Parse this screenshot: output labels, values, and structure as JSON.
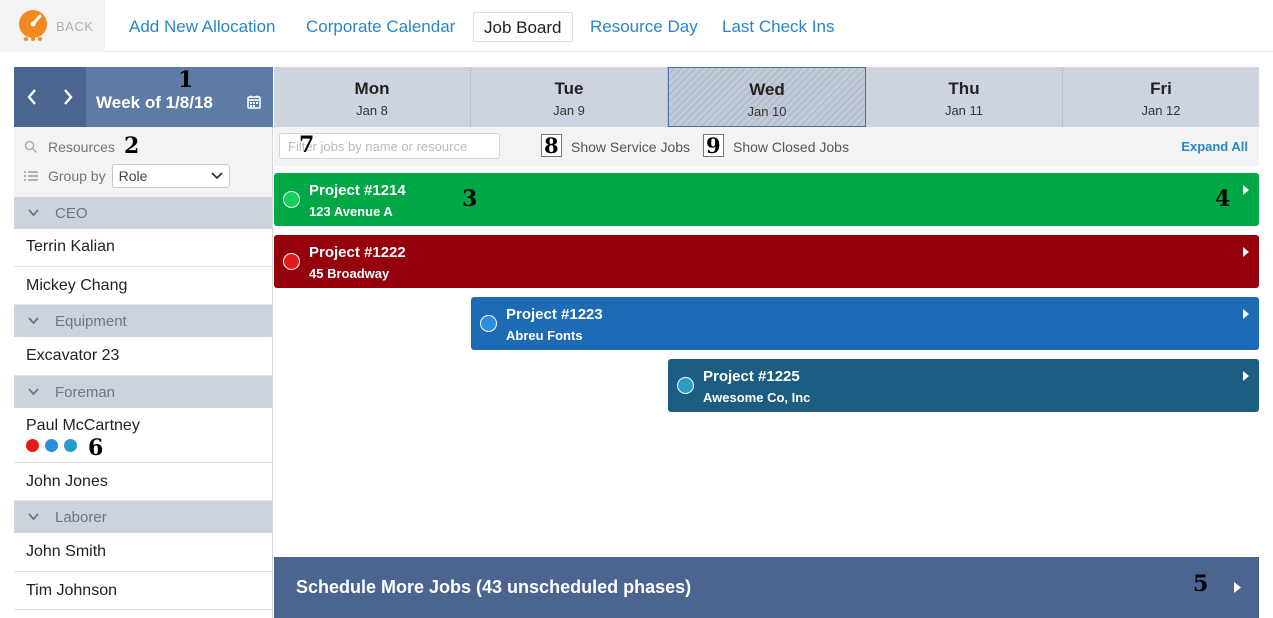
{
  "nav": {
    "back_label": "BACK",
    "links": [
      "Add New Allocation",
      "Corporate Calendar",
      "Job Board",
      "Resource Day",
      "Last Check Ins"
    ],
    "active": "Job Board"
  },
  "sidebar": {
    "week_label": "Week of 1/8/18",
    "resources_label": "Resources",
    "group_by_label": "Group by",
    "group_by_value": "Role",
    "groups": [
      {
        "name": "CEO",
        "people": [
          {
            "name": "Terrin Kalian"
          },
          {
            "name": "Mickey Chang"
          }
        ]
      },
      {
        "name": "Equipment",
        "people": [
          {
            "name": "Excavator 23"
          }
        ]
      },
      {
        "name": "Foreman",
        "people": [
          {
            "name": "Paul McCartney",
            "dots": [
              "#e21b1b",
              "#2a8de0",
              "#2a9cc8"
            ]
          },
          {
            "name": "John Jones"
          }
        ]
      },
      {
        "name": "Laborer",
        "people": [
          {
            "name": "John Smith"
          },
          {
            "name": "Tim Johnson"
          }
        ]
      }
    ]
  },
  "calendar": {
    "days": [
      {
        "name": "Mon",
        "date": "Jan 8"
      },
      {
        "name": "Tue",
        "date": "Jan 9"
      },
      {
        "name": "Wed",
        "date": "Jan 10",
        "active": true
      },
      {
        "name": "Thu",
        "date": "Jan 11"
      },
      {
        "name": "Fri",
        "date": "Jan 12"
      }
    ]
  },
  "filters": {
    "job_filter_placeholder": "Filter jobs by name or resource",
    "show_service_jobs": "Show Service Jobs",
    "show_closed_jobs": "Show Closed Jobs",
    "expand_all": "Expand All"
  },
  "jobs": [
    {
      "title": "Project #1214",
      "subtitle": "123 Avenue A",
      "color": "#00a845",
      "dot_color": "#14d05a"
    },
    {
      "title": "Project #1222",
      "subtitle": "45 Broadway",
      "color": "#95000c",
      "dot_color": "#e21b1b"
    },
    {
      "title": "Project #1223",
      "subtitle": "Abreu Fonts",
      "color": "#1d6ab5",
      "dot_color": "#2a8de0"
    },
    {
      "title": "Project #1225",
      "subtitle": "Awesome Co, Inc",
      "color": "#1c5e82",
      "dot_color": "#2a9cc8"
    }
  ],
  "schedule_more": "Schedule More Jobs (43 unscheduled phases)",
  "callouts": [
    "1",
    "2",
    "3",
    "4",
    "5",
    "6",
    "7",
    "8",
    "9"
  ]
}
